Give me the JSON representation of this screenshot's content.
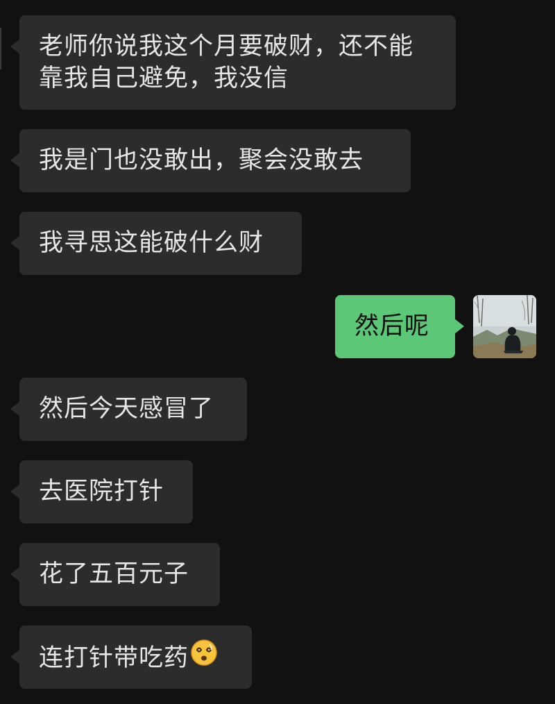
{
  "conversation": {
    "messages": [
      {
        "side": "incoming",
        "lines": [
          "老师你说我这个月要破财，还不能",
          "靠我自己避免，我没信"
        ]
      },
      {
        "side": "incoming",
        "text": "我是门也没敢出，聚会没敢去"
      },
      {
        "side": "incoming",
        "text": "我寻思这能破什么财"
      },
      {
        "side": "outgoing",
        "text": "然后呢"
      },
      {
        "side": "incoming",
        "text": "然后今天感冒了"
      },
      {
        "side": "incoming",
        "text": "去医院打针"
      },
      {
        "side": "incoming",
        "text": "花了五百元子"
      },
      {
        "side": "incoming",
        "text": "连打针带吃药",
        "emoji": "dizzy-face-emoji"
      }
    ]
  },
  "colors": {
    "background": "#111111",
    "incoming_bubble": "#2c2c2c",
    "outgoing_bubble": "#5bc777",
    "incoming_text": "#e6e6e6",
    "outgoing_text": "#101010"
  }
}
